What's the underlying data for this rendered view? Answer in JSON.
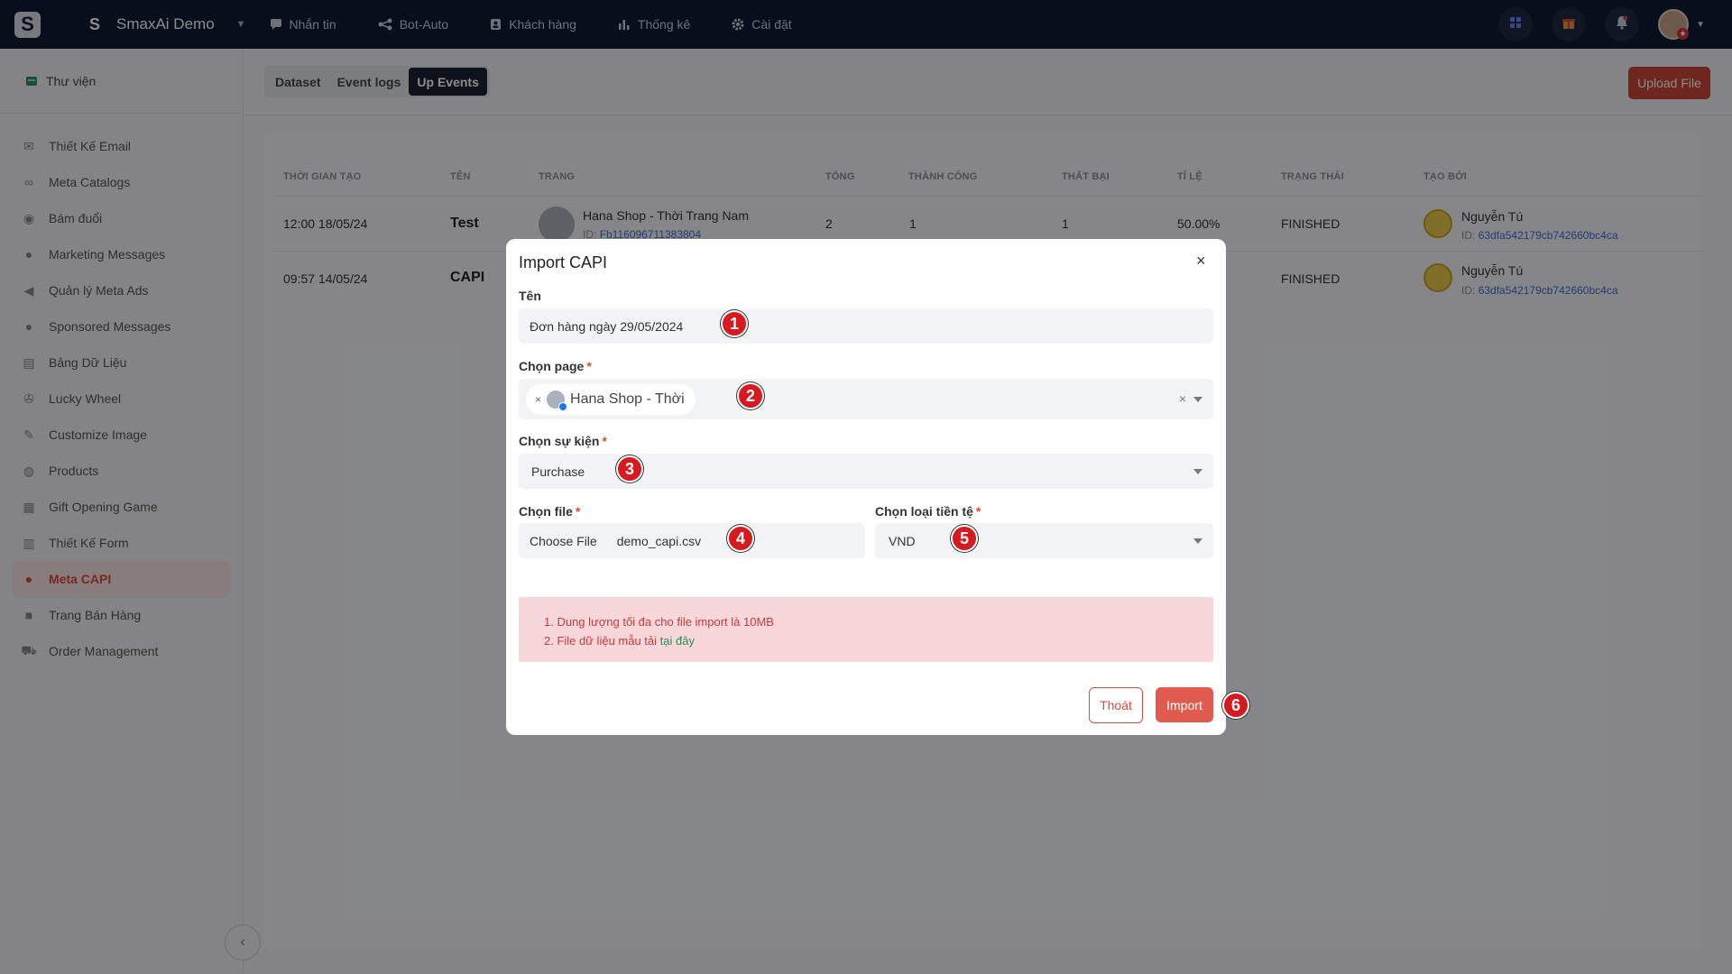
{
  "topnav": {
    "logo": "S",
    "workspace_letter": "S",
    "workspace_name": "SmaxAi Demo",
    "items": [
      {
        "label": "Nhắn tin",
        "icon": "chat-icon"
      },
      {
        "label": "Bot-Auto",
        "icon": "share-nodes-icon"
      },
      {
        "label": "Khách hàng",
        "icon": "contact-icon"
      },
      {
        "label": "Thống kê",
        "icon": "bar-chart-icon"
      },
      {
        "label": "Cài đặt",
        "icon": "gear-icon"
      }
    ]
  },
  "sidebar": {
    "library": "Thư viện",
    "items": [
      {
        "label": "Thiết Kế Email",
        "icon": "email-icon"
      },
      {
        "label": "Meta Catalogs",
        "icon": "infinity-icon"
      },
      {
        "label": "Bám đuổi",
        "icon": "eye-icon"
      },
      {
        "label": "Marketing Messages",
        "icon": "message-icon"
      },
      {
        "label": "Quản lý Meta Ads",
        "icon": "megaphone-icon"
      },
      {
        "label": "Sponsored Messages",
        "icon": "message-icon"
      },
      {
        "label": "Bảng Dữ Liệu",
        "icon": "table-icon"
      },
      {
        "label": "Lucky Wheel",
        "icon": "wheel-icon"
      },
      {
        "label": "Customize Image",
        "icon": "brush-icon"
      },
      {
        "label": "Products",
        "icon": "box-icon"
      },
      {
        "label": "Gift Opening Game",
        "icon": "gift-icon"
      },
      {
        "label": "Thiết Kế Form",
        "icon": "form-icon"
      },
      {
        "label": "Meta CAPI",
        "icon": "capi-icon",
        "active": true
      },
      {
        "label": "Trang Bán Hàng",
        "icon": "bag-icon"
      },
      {
        "label": "Order Management",
        "icon": "cart-icon"
      }
    ]
  },
  "tabs": [
    "Dataset",
    "Event logs",
    "Up Events"
  ],
  "upload_button": "Upload File",
  "table": {
    "headers": [
      "THỜI GIAN TẠO",
      "TÊN",
      "TRANG",
      "TỔNG",
      "THÀNH CÔNG",
      "THẤT BẠI",
      "TỈ LỆ",
      "TRẠNG THÁI",
      "TẠO BỞI"
    ],
    "rows": [
      {
        "time": "12:00 18/05/24",
        "name": "Test",
        "page": "Hana Shop - Thời Trang Nam",
        "page_id_label": "ID:",
        "page_id": "Fb116096711383804",
        "total": "2",
        "success": "1",
        "fail": "1",
        "rate": "50.00%",
        "status": "FINISHED",
        "user": "Nguyễn Tú",
        "user_id_label": "ID:",
        "user_id": "63dfa542179cb742660bc4ca"
      },
      {
        "time": "09:57 14/05/24",
        "name": "CAPI",
        "status": "FINISHED",
        "user": "Nguyễn Tú",
        "user_id_label": "ID:",
        "user_id": "63dfa542179cb742660bc4ca"
      }
    ]
  },
  "modal": {
    "title": "Import CAPI",
    "close": "×",
    "name_label": "Tên",
    "name_value": "Đơn hàng ngày 29/05/2024",
    "page_label": "Chọn page",
    "page_chip": "Hana Shop - Thời",
    "chip_remove": "×",
    "page_clear": "×",
    "event_label": "Chọn sự kiện",
    "event_value": "Purchase",
    "file_label": "Chọn file",
    "file_button": "Choose File",
    "file_name": "demo_capi.csv",
    "currency_label": "Chọn loại tiền tệ",
    "currency_value": "VND",
    "required_mark": "*",
    "notice_1": "1. Dung lượng tối đa cho file import là 10MB",
    "notice_2_prefix": "2. File dữ liệu mẫu tải",
    "notice_2_link": "tại đây",
    "exit_button": "Thoát",
    "import_button": "Import"
  },
  "steps": [
    "1",
    "2",
    "3",
    "4",
    "5",
    "6"
  ],
  "colors": {
    "nav_bg": "#0e1a33",
    "accent": "#d94b3e",
    "active_bg": "#f8e2e2",
    "step": "#d71920"
  }
}
